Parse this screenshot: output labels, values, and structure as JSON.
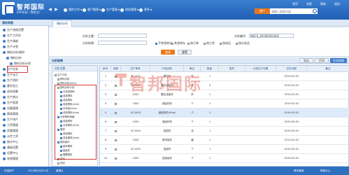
{
  "brand": {
    "name": "智邦国际",
    "subtitle": "ERP系统（零售业）"
  },
  "nav": [
    {
      "label": "我的工作"
    },
    {
      "label": "客户管理"
    },
    {
      "label": "生产管理"
    },
    {
      "label": "财务管理"
    },
    {
      "label": "更多"
    }
  ],
  "search": {
    "category": "客户",
    "placeholder": "请输入搜索内容"
  },
  "header_links": [
    "首页",
    "消息",
    "帮助",
    "退出"
  ],
  "sidebar": {
    "title": "我的导航",
    "items": [
      {
        "label": "生产流程设置"
      },
      {
        "label": "生产工作台"
      },
      {
        "label": "生产调度"
      },
      {
        "label": "生产计划"
      },
      {
        "label": "物料分析/维护"
      },
      {
        "label": "物料分析"
      },
      {
        "label": "物料分析计划"
      },
      {
        "label": "生产任务"
      },
      {
        "label": "生产派工"
      },
      {
        "label": "生产质检"
      },
      {
        "label": "委外加工"
      },
      {
        "label": "成本核算"
      },
      {
        "label": "生产统计"
      },
      {
        "label": "生产报表"
      },
      {
        "label": "设备管理"
      },
      {
        "label": "模具管理"
      },
      {
        "label": "生产排产"
      },
      {
        "label": "工序管理"
      },
      {
        "label": "质量管理"
      },
      {
        "label": "计件工资"
      },
      {
        "label": "统计中心"
      },
      {
        "label": "基础设置"
      },
      {
        "label": "设置中心"
      },
      {
        "label": "系统管理"
      }
    ]
  },
  "tab": {
    "label": "物料分析"
  },
  "filter": {
    "field1_label": "分析主题：",
    "field2_label": "分析结果：",
    "field3_label": "分析编号：",
    "field3_value": "WLFX_20190301001",
    "options": [
      "不考虑库存",
      "考虑库存",
      "按订单",
      "按工序",
      "按成品",
      "按半成品"
    ],
    "query_label": "查询",
    "reset_label": "重置"
  },
  "list_bar": {
    "title": "分析结果",
    "buttons": [
      "导出",
      "打印",
      "生成采购"
    ]
  },
  "tree": {
    "title": "分析主题",
    "items": [
      "生产计划",
      "物料分析",
      "物料分析(Kine)",
      "物料分析计划",
      "半成品物料",
      "成品物料",
      "成品物料",
      "成品物料(kine)",
      "半成品(kine)",
      "成品物料(kine)",
      "分析物料明细",
      "成品物料",
      "分析物料(kine)",
      "需求",
      "成品物料",
      "成品需求(kine)",
      "物料组件",
      "部件需求",
      "组装件",
      "需要物料",
      "结束",
      "完成"
    ]
  },
  "grid": {
    "columns": [
      "序号",
      "选择",
      "生产单号",
      "产品名称",
      "单位",
      "数量",
      "型号",
      "计划生产日期",
      "交货日期",
      "备注"
    ],
    "rows": [
      [
        "1",
        "",
        "SC1001",
        "模压件",
        "件",
        "1",
        "",
        "",
        "2019-03-01",
        ""
      ],
      [
        "2",
        "",
        "SC1002",
        "模压连接件",
        "件",
        "2",
        "",
        "",
        "2019-03-01",
        ""
      ],
      [
        "3",
        "",
        "1002",
        "模压连接件",
        "件",
        "1",
        "",
        "",
        "2019-03-01",
        ""
      ],
      [
        "4",
        "",
        "1002",
        "钢结构件",
        "个",
        "1",
        "",
        "",
        "2019-03-01",
        ""
      ],
      [
        "5",
        "",
        "SC1003",
        "钢结构件(Kine)",
        "个",
        "1",
        "",
        "",
        "2019-03-01",
        ""
      ],
      [
        "6",
        "",
        "1003",
        "钢结构件",
        "个",
        "1",
        "",
        "",
        "2019-03-01",
        ""
      ],
      [
        "7",
        "",
        "SC1004",
        "铝型材",
        "米",
        "1",
        "",
        "",
        "2019-03-01",
        ""
      ],
      [
        "8",
        "",
        "1004",
        "型材组件",
        "套",
        "1",
        "",
        "",
        "2019-03-01",
        ""
      ],
      [
        "9",
        "",
        "SC1005",
        "连接件",
        "个",
        "1",
        "",
        "",
        "2019-03-01",
        ""
      ],
      [
        "10",
        "",
        "1005",
        "连接组件",
        "个",
        "1",
        "",
        "",
        "2019-03-01",
        ""
      ]
    ]
  },
  "watermark": "智邦国际",
  "statusbar": {
    "left": [
      "在线用户",
      "2019年03月01日",
      "星期五"
    ],
    "right": [
      "联系客服",
      "帮助中心"
    ]
  },
  "colors": {
    "header": "#1f5fb3",
    "accent": "#e8781c",
    "selected_row": "#dceafa",
    "highlight_box": "#d23b3b"
  }
}
